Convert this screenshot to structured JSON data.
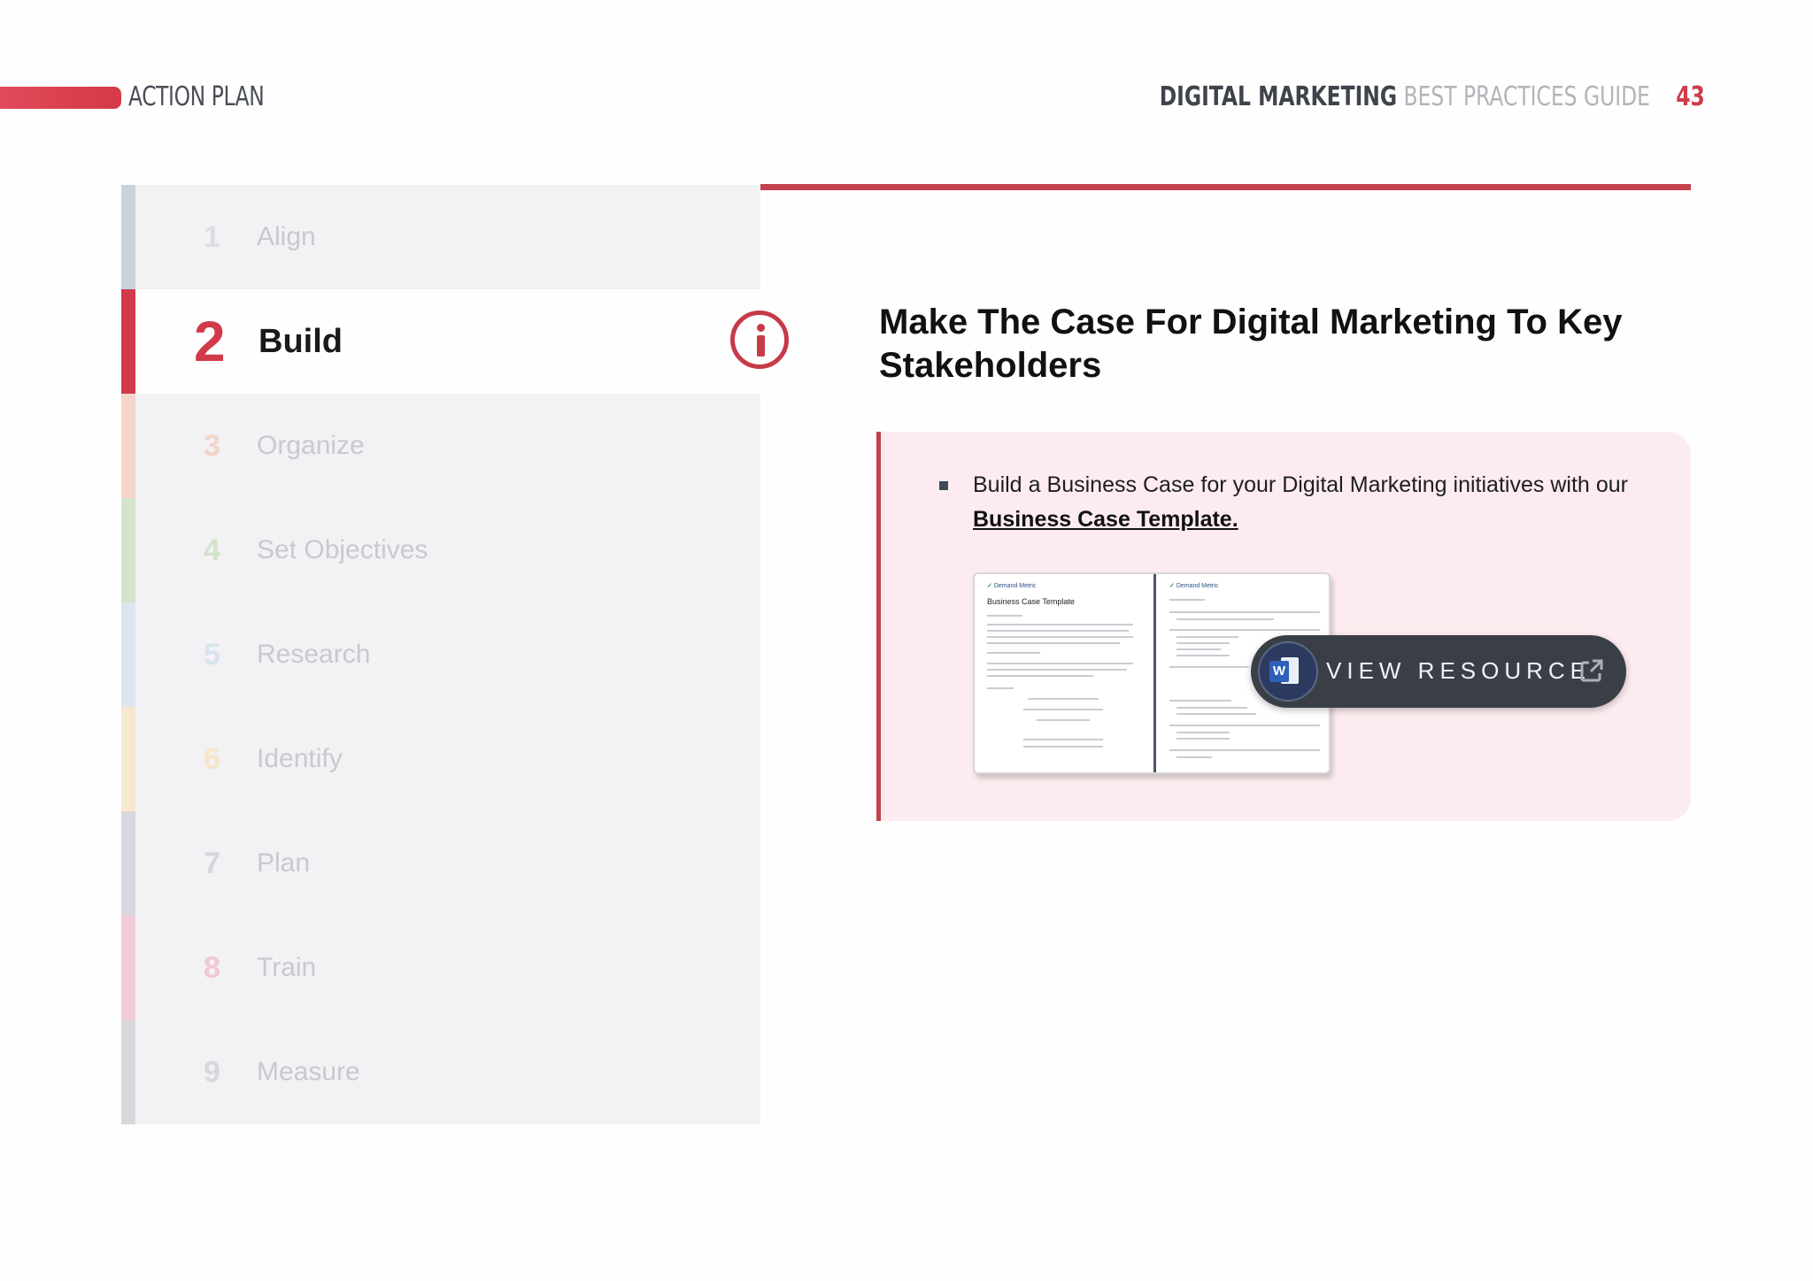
{
  "header": {
    "section_label": "ACTION PLAN",
    "guide_title_bold": "DIGITAL MARKETING",
    "guide_title_light": "BEST PRACTICES GUIDE",
    "page_number": "43"
  },
  "steps": [
    {
      "number": "1",
      "label": "Align",
      "color": "#c9d3dc",
      "num_color": "#d8dde2"
    },
    {
      "number": "2",
      "label": "Build",
      "color": "#d13a4a",
      "num_color": "#d13a4a",
      "active": true
    },
    {
      "number": "3",
      "label": "Organize",
      "color": "#f4d6cc",
      "num_color": "#f3d4c8"
    },
    {
      "number": "4",
      "label": "Set Objectives",
      "color": "#d3e4cd",
      "num_color": "#d0e3c8"
    },
    {
      "number": "5",
      "label": "Research",
      "color": "#dbe6ef",
      "num_color": "#d6e4ee"
    },
    {
      "number": "6",
      "label": "Identify",
      "color": "#f6e9cf",
      "num_color": "#f6e6c6"
    },
    {
      "number": "7",
      "label": "Plan",
      "color": "#d9d7e0",
      "num_color": "#d6d4dc"
    },
    {
      "number": "8",
      "label": "Train",
      "color": "#f1ccd6",
      "num_color": "#f0c8d2"
    },
    {
      "number": "9",
      "label": "Measure",
      "color": "#d8d8dc",
      "num_color": "#d7d7db"
    }
  ],
  "main": {
    "title": "Make The Case For Digital Marketing To Key Stakeholders",
    "bullet_text": "Build a Business Case for your Digital Marketing initiatives with our",
    "bullet_link": "Business Case Template.",
    "preview": {
      "brand": "Demand Metric",
      "doc_title": "Business Case Template"
    },
    "button_label": "VIEW RESOURCE",
    "word_icon_letter": "W"
  },
  "colors": {
    "accent": "#d13a4a",
    "callout_bg": "#fdecef",
    "button_bg": "#3a3f47"
  }
}
